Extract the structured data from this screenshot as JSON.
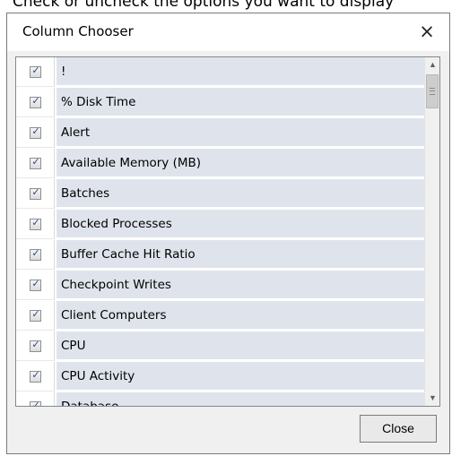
{
  "caption": "Check or uncheck the options you want to display",
  "dialog": {
    "title": "Column Chooser",
    "close_icon": "close-icon",
    "close_glyph": "×",
    "close_button_label": "Close"
  },
  "columns": [
    {
      "label": "!",
      "checked": true
    },
    {
      "label": "% Disk Time",
      "checked": true
    },
    {
      "label": "Alert",
      "checked": true
    },
    {
      "label": "Available Memory (MB)",
      "checked": true
    },
    {
      "label": "Batches",
      "checked": true
    },
    {
      "label": "Blocked Processes",
      "checked": true
    },
    {
      "label": "Buffer Cache Hit Ratio",
      "checked": true
    },
    {
      "label": "Checkpoint Writes",
      "checked": true
    },
    {
      "label": "Client Computers",
      "checked": true
    },
    {
      "label": "CPU",
      "checked": true
    },
    {
      "label": "CPU Activity",
      "checked": true
    },
    {
      "label": "Database",
      "checked": true
    }
  ],
  "checkmark_glyph": "✓",
  "scrollbar": {
    "up_glyph": "▲",
    "down_glyph": "▼"
  }
}
